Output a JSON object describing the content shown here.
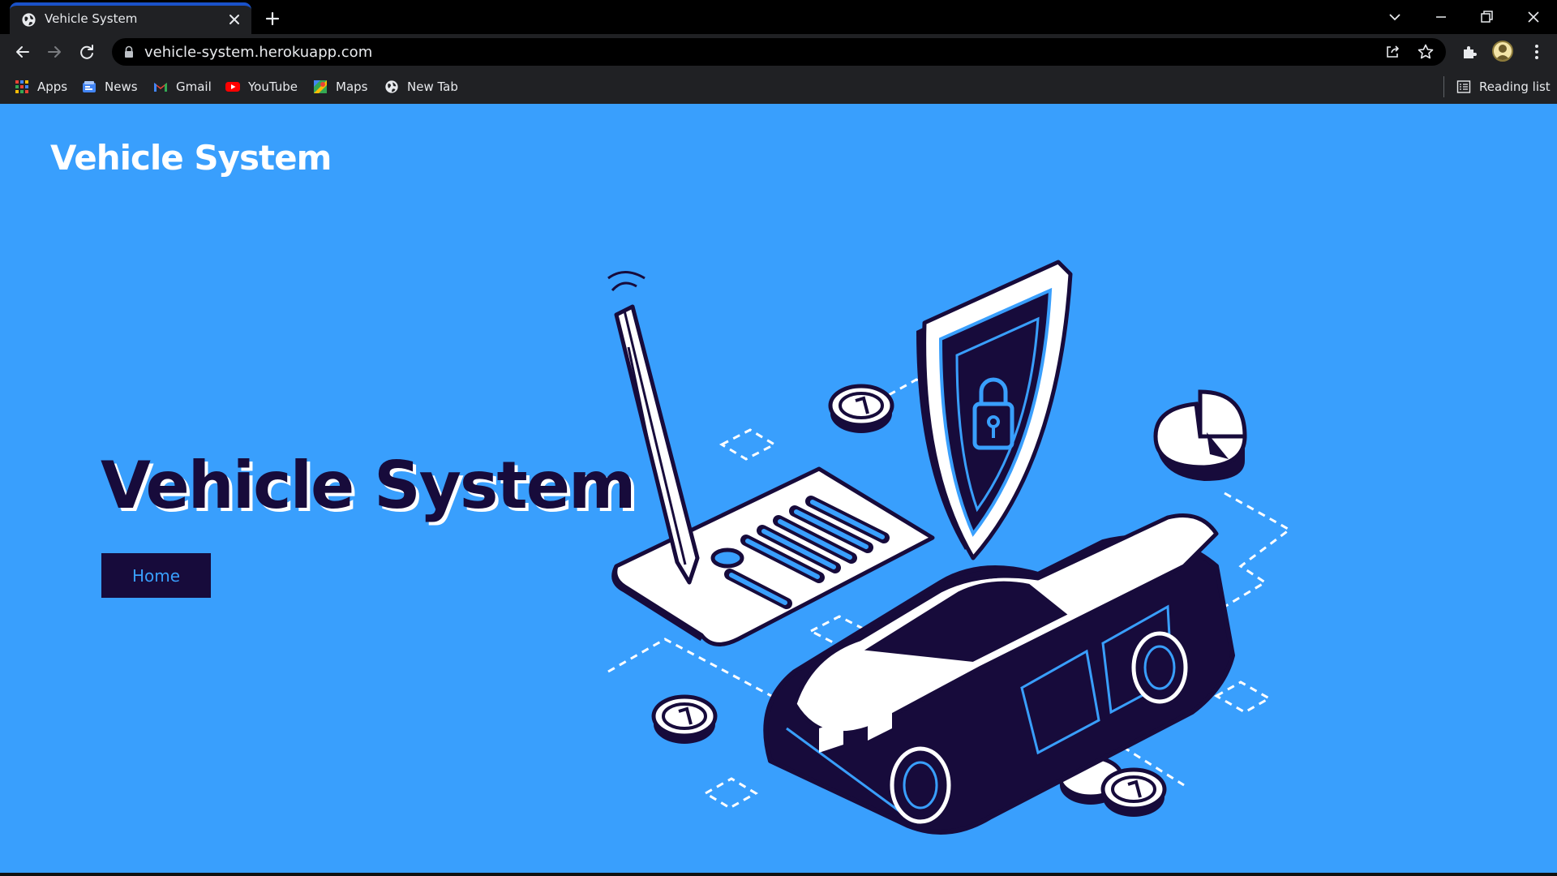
{
  "browser": {
    "tab": {
      "title": "Vehicle System"
    },
    "address_bar": {
      "url": "vehicle-system.herokuapp.com"
    },
    "bookmarks": [
      {
        "label": "Apps",
        "icon": "apps-grid-icon"
      },
      {
        "label": "News",
        "icon": "news-icon"
      },
      {
        "label": "Gmail",
        "icon": "gmail-icon"
      },
      {
        "label": "YouTube",
        "icon": "youtube-icon"
      },
      {
        "label": "Maps",
        "icon": "maps-icon"
      },
      {
        "label": "New Tab",
        "icon": "globe-icon"
      }
    ],
    "reading_list": {
      "label": "Reading list",
      "icon": "reading-list-icon"
    }
  },
  "page": {
    "brand": "Vehicle System",
    "hero": {
      "title": "Vehicle System",
      "button_label": "Home"
    }
  },
  "colors": {
    "page_background": "#399ffd",
    "dark_navy": "#170b3b",
    "white": "#ffffff",
    "chrome_dark": "#202124",
    "tab_accent": "#1a52c9"
  }
}
